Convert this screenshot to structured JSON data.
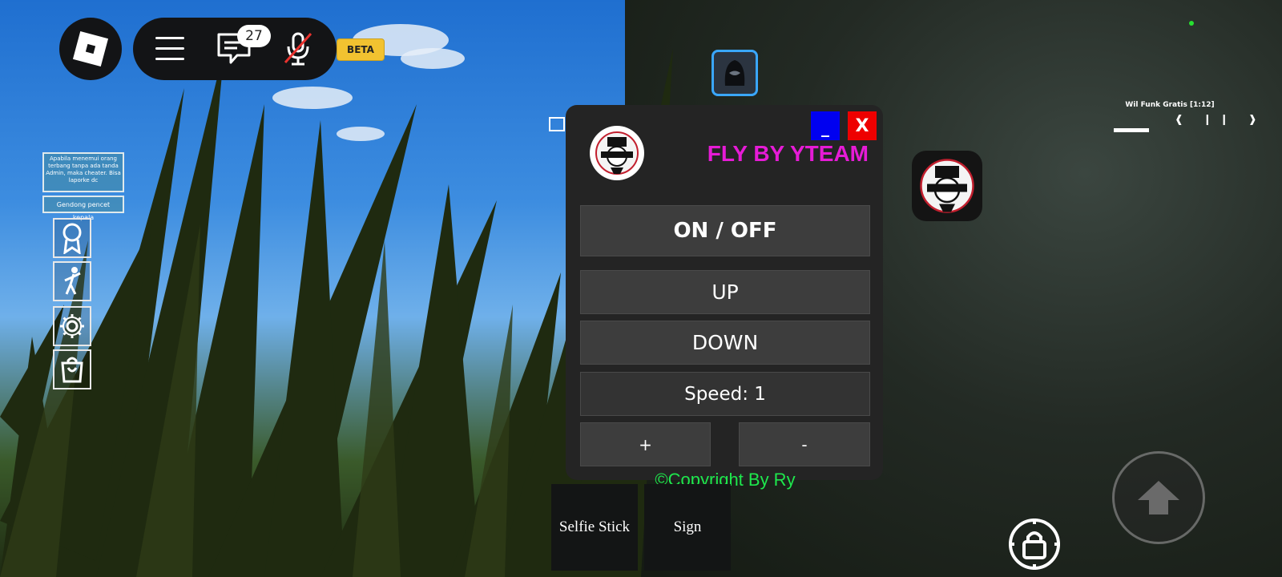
{
  "topbar": {
    "chat_count": "27",
    "beta_label": "BETA"
  },
  "side_notes": [
    "Apabila menemui orang terbang tanpa ada tanda Admin, maka cheater. Bisa laporke dc",
    "Gendong pencet kepala"
  ],
  "fly_panel": {
    "title": "FLY BY YTEAM",
    "minimize_label": "_",
    "close_label": "X",
    "toggle_label": "ON / OFF",
    "up_label": "UP",
    "down_label": "DOWN",
    "speed_label": "Speed: 1",
    "plus_label": "+",
    "minus_label": "-",
    "copyright": "©Copyright By Ry"
  },
  "tools": [
    "Selfie Stick",
    "Sign"
  ],
  "music": {
    "title": "Wil Funk Gratis [1:12]",
    "controls": "❰ ❙❙ ❱"
  },
  "colors": {
    "panel_title": "#e61bd6",
    "copyright": "#1ee84d",
    "minimize": "#0000f0",
    "close": "#ee0000",
    "beta": "#f2c230"
  }
}
